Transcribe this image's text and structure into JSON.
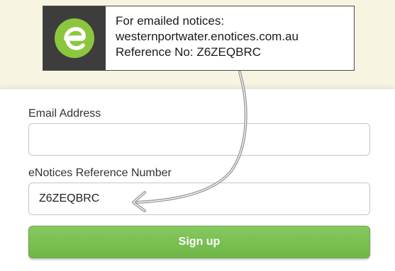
{
  "notice": {
    "logo_letter": "e",
    "line1": "For emailed notices:",
    "line2": "westernportwater.enotices.com.au",
    "line3": "Reference No: Z6ZEQBRC"
  },
  "form": {
    "email_label": "Email Address",
    "email_value": "",
    "reference_label": "eNotices Reference Number",
    "reference_value": "Z6ZEQBRC",
    "signup_label": "Sign up"
  },
  "colors": {
    "brand_green": "#8cc63f",
    "button_green": "#76bd4e",
    "logo_background": "#3d3d3d",
    "arrow": "#8a8a8a"
  },
  "icons": {
    "logo": "enotices-e-logo-icon",
    "connector": "curved-arrow-icon"
  }
}
